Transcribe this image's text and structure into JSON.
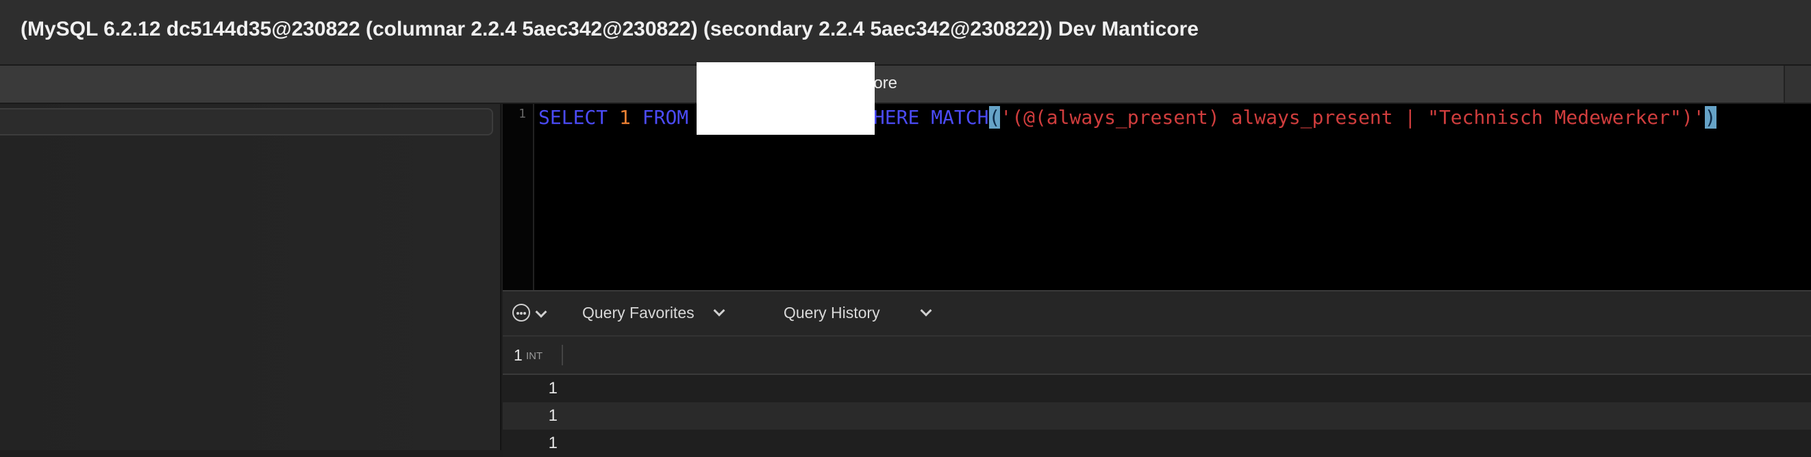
{
  "window": {
    "title": "(MySQL 6.2.12 dc5144d35@230822 (columnar 2.2.4 5aec342@230822) (secondary 2.2.4 5aec342@230822)) Dev Manticore"
  },
  "tab": {
    "label": "icore"
  },
  "editor": {
    "line_number": "1",
    "tokens": {
      "select": "SELECT",
      "one": "1",
      "from": "FROM",
      "gap": "              ",
      "where": "WHERE",
      "match": "MATCH",
      "open_paren": "(",
      "string": "'(@(always_present) always_present | \"Technisch Medewerker\")'",
      "close_paren": ")"
    }
  },
  "query_bar": {
    "favorites_label": "Query Favorites",
    "history_label": "Query History"
  },
  "results": {
    "column": {
      "name": "1",
      "type": "INT"
    },
    "rows": [
      "1",
      "1",
      "1"
    ]
  },
  "colors": {
    "keyword": "#4b4bf6",
    "number": "#ef8133",
    "string": "#cf3d3d",
    "bracket_highlight": "#66a3c7"
  }
}
